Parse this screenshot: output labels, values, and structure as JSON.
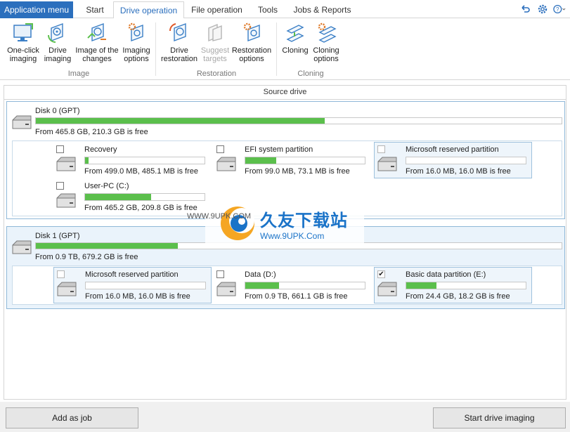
{
  "tabs": {
    "app_menu": "Application menu",
    "items": [
      "Start",
      "Drive operation",
      "File operation",
      "Tools",
      "Jobs & Reports"
    ],
    "active": "Drive operation"
  },
  "toolbar_icons": [
    "undo-icon",
    "gear-icon",
    "help-icon"
  ],
  "ribbon": {
    "buttons": [
      {
        "label1": "One-click",
        "label2": "imaging",
        "icon": "monitor-icon",
        "enabled": true
      },
      {
        "label1": "Drive",
        "label2": "imaging",
        "icon": "drive-image-icon",
        "enabled": true
      },
      {
        "label1": "Image of the",
        "label2": "changes",
        "icon": "image-changes-icon",
        "enabled": true
      },
      {
        "label1": "Imaging",
        "label2": "options",
        "icon": "imaging-options-icon",
        "enabled": true
      },
      {
        "label1": "Drive",
        "label2": "restoration",
        "icon": "drive-restoration-icon",
        "enabled": true
      },
      {
        "label1": "Suggest",
        "label2": "targets",
        "icon": "suggest-targets-icon",
        "enabled": false
      },
      {
        "label1": "Restoration",
        "label2": "options",
        "icon": "restoration-options-icon",
        "enabled": true
      },
      {
        "label1": "Cloning",
        "label2": "",
        "icon": "cloning-icon",
        "enabled": true
      },
      {
        "label1": "Cloning",
        "label2": "options",
        "icon": "cloning-options-icon",
        "enabled": true
      }
    ],
    "groups": [
      "Image",
      "Restoration",
      "Cloning"
    ]
  },
  "source": {
    "title": "Source drive",
    "disks": [
      {
        "name": "Disk 0 (GPT)",
        "info": "From 465.8 GB, 210.3 GB is free",
        "used_fraction": 0.55,
        "partitions": [
          {
            "name": "Recovery",
            "info": "From 499.0 MB, 485.1 MB is free",
            "used_fraction": 0.03,
            "checked": false,
            "highlight": false
          },
          {
            "name": "EFI system partition",
            "info": "From 99.0 MB, 73.1 MB is free",
            "used_fraction": 0.26,
            "checked": false,
            "highlight": false
          },
          {
            "name": "Microsoft reserved partition",
            "info": "From 16.0 MB, 16.0 MB is free",
            "used_fraction": 0.0,
            "checked": false,
            "highlight": true
          },
          {
            "name": "User-PC (C:)",
            "info": "From 465.2 GB, 209.8 GB is free",
            "used_fraction": 0.55,
            "checked": false,
            "highlight": false
          }
        ]
      },
      {
        "name": "Disk 1 (GPT)",
        "info": "From 0.9 TB, 679.2 GB is free",
        "used_fraction": 0.27,
        "partitions": [
          {
            "name": "Microsoft reserved partition",
            "info": "From 16.0 MB, 16.0 MB is free",
            "used_fraction": 0.0,
            "checked": false,
            "highlight": true
          },
          {
            "name": "Data (D:)",
            "info": "From 0.9 TB, 661.1 GB is free",
            "used_fraction": 0.28,
            "checked": false,
            "highlight": false
          },
          {
            "name": "Basic data partition (E:)",
            "info": "From 24.4 GB, 18.2 GB is free",
            "used_fraction": 0.25,
            "checked": true,
            "highlight": true
          }
        ]
      }
    ]
  },
  "buttons": {
    "add_job": "Add as job",
    "start": "Start drive imaging"
  },
  "watermark": {
    "brand": "久友下载站",
    "url": "Www.9UPK.Com",
    "left_text": "WWW.9UPK.COM"
  },
  "colors": {
    "accent": "#2b6fbd",
    "bar": "#5bbf4c",
    "selected_border": "#8fb8d8"
  }
}
